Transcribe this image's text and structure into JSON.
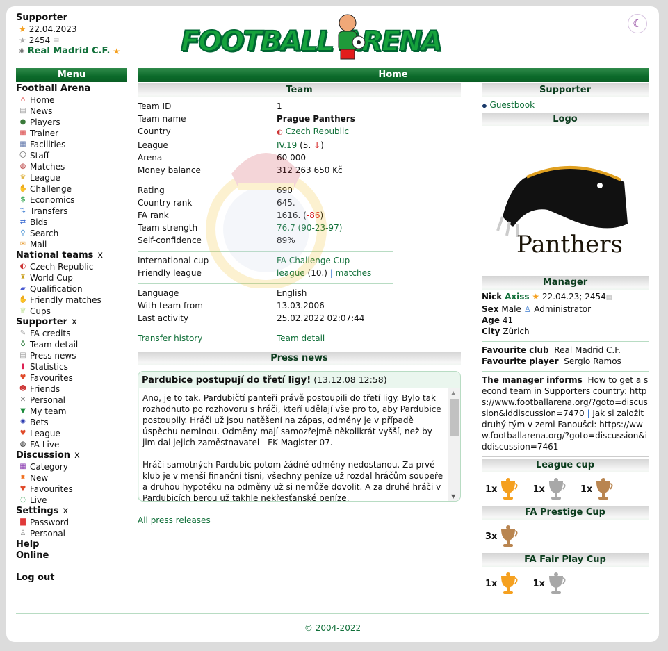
{
  "header": {
    "supporter_title": "Supporter",
    "supporter_until": "22.04.2023",
    "credits": "2454",
    "club": "Real Madrid C.F.",
    "logo_text": "FOOTBALL ARENA",
    "theme_toggle": "dark-mode"
  },
  "menu": {
    "title": "Menu",
    "sections": {
      "fa": {
        "label": "Football Arena",
        "items": [
          "Home",
          "News",
          "Players",
          "Trainer",
          "Facilities",
          "Staff",
          "Matches",
          "League",
          "Challenge",
          "Economics",
          "Transfers",
          "Bids",
          "Search",
          "Mail"
        ]
      },
      "national": {
        "label": "National teams",
        "close": "x",
        "items": [
          "Czech Republic",
          "World Cup",
          "Qualification",
          "Friendly matches",
          "Cups"
        ]
      },
      "supporter": {
        "label": "Supporter",
        "close": "x",
        "items": [
          "FA credits",
          "Team detail",
          "Press news",
          "Statistics",
          "Favourites",
          "Friends",
          "Personal",
          "My team",
          "Bets",
          "League",
          "FA Live"
        ]
      },
      "discussion": {
        "label": "Discussion",
        "close": "x",
        "items": [
          "Category",
          "New",
          "Favourites",
          "Live"
        ]
      },
      "settings": {
        "label": "Settings",
        "close": "x",
        "items": [
          "Password",
          "Personal"
        ]
      },
      "help": "Help",
      "online": "Online",
      "logout": "Log out"
    }
  },
  "main": {
    "title": "Home",
    "team": {
      "heading": "Team",
      "team_id_label": "Team ID",
      "team_id": "1",
      "team_name_label": "Team name",
      "team_name": "Prague Panthers",
      "country_label": "Country",
      "country": "Czech Republic",
      "league_label": "League",
      "league": "IV.19",
      "league_pos": "(5.",
      "league_pos_end": ")",
      "arena_label": "Arena",
      "arena": "60 000",
      "money_label": "Money balance",
      "money": "312 263 650 Kč",
      "rating_label": "Rating",
      "rating": "690",
      "country_rank_label": "Country rank",
      "country_rank": "645.",
      "fa_rank_label": "FA rank",
      "fa_rank": "1616.",
      "fa_rank_change": "-86",
      "strength_label": "Team strength",
      "strength": "76.7",
      "strength_detail": "(90-23-97)",
      "confidence_label": "Self-confidence",
      "confidence": "89%",
      "intl_cup_label": "International cup",
      "intl_cup": "FA Challenge Cup",
      "friendly_label": "Friendly league",
      "friendly_league": "league",
      "friendly_pos": "(10.)",
      "friendly_sep": "|",
      "friendly_matches": "matches",
      "language_label": "Language",
      "language": "English",
      "with_team_label": "With team from",
      "with_team": "13.03.2006",
      "last_activity_label": "Last activity",
      "last_activity": "25.02.2022 02:07:44",
      "transfer_history": "Transfer history",
      "team_detail": "Team detail"
    },
    "press": {
      "heading": "Press news",
      "article_title": "Pardubice postupují do třetí ligy!",
      "article_date": "(13.12.08 12:58)",
      "article_body": "Ano, je to tak. Pardubičtí panteři právě postoupili do třetí ligy. Bylo tak rozhodnuto po rozhovoru s hráči, kteří udělají vše pro to, aby Pardubice postoupily. Hráči už jsou natěšení na zápas, odměny je v případě úspěchu neminou. Odměny mají samozřejmě několikrát vyšší, než by jim dal jejich zaměstnavatel - FK Magister 07.\n\nHráči samotných Pardubic potom žádné odměny nedostanou. Za prvé klub je v menší finanční tísni, všechny peníze už rozdal hráčům soupeře a druhou hypotéku na odměny už si nemůže dovolit. A za druhé hráči v Pardubicích berou už takhle nekřesťanské peníze.",
      "all_releases": "All press releases"
    },
    "right": {
      "supporter_heading": "Supporter",
      "guestbook": "Guestbook",
      "logo_heading": "Logo",
      "logo_caption": "Panthers",
      "manager_heading": "Manager",
      "nick_label": "Nick",
      "nick": "Axiss",
      "nick_meta": "22.04.23; 2454",
      "sex_label": "Sex",
      "sex": "Male",
      "role": "Administrator",
      "age_label": "Age",
      "age": "41",
      "city_label": "City",
      "city": "Zürich",
      "fav_club_label": "Favourite club",
      "fav_club": "Real Madrid C.F.",
      "fav_player_label": "Favourite player",
      "fav_player": "Sergio Ramos",
      "informs_label": "The manager informs",
      "informs_1": "How to get a second team in Supporters country: https://www.footballarena.org/?goto=discussion&iddiscussion=7470",
      "informs_sep": "|",
      "informs_2": "Jak si založit druhý tým v zemi Fanoušci: https://www.footballarena.org/?goto=discussion&iddiscussion=7461",
      "league_cup_heading": "League cup",
      "league_cup": [
        {
          "count": "1x",
          "medal": "gold"
        },
        {
          "count": "1x",
          "medal": "silver"
        },
        {
          "count": "1x",
          "medal": "bronze"
        }
      ],
      "prestige_heading": "FA Prestige Cup",
      "prestige": [
        {
          "count": "3x",
          "medal": "bronze"
        }
      ],
      "fairplay_heading": "FA Fair Play Cup",
      "fairplay": [
        {
          "count": "1x",
          "medal": "gold"
        },
        {
          "count": "1x",
          "medal": "silver"
        }
      ]
    }
  },
  "colors": {
    "gold": "#f5a01f",
    "silver": "#a8a8a8",
    "bronze": "#b98550",
    "accent": "#12703a"
  },
  "footer": {
    "copyright": "© 2004-2022"
  }
}
